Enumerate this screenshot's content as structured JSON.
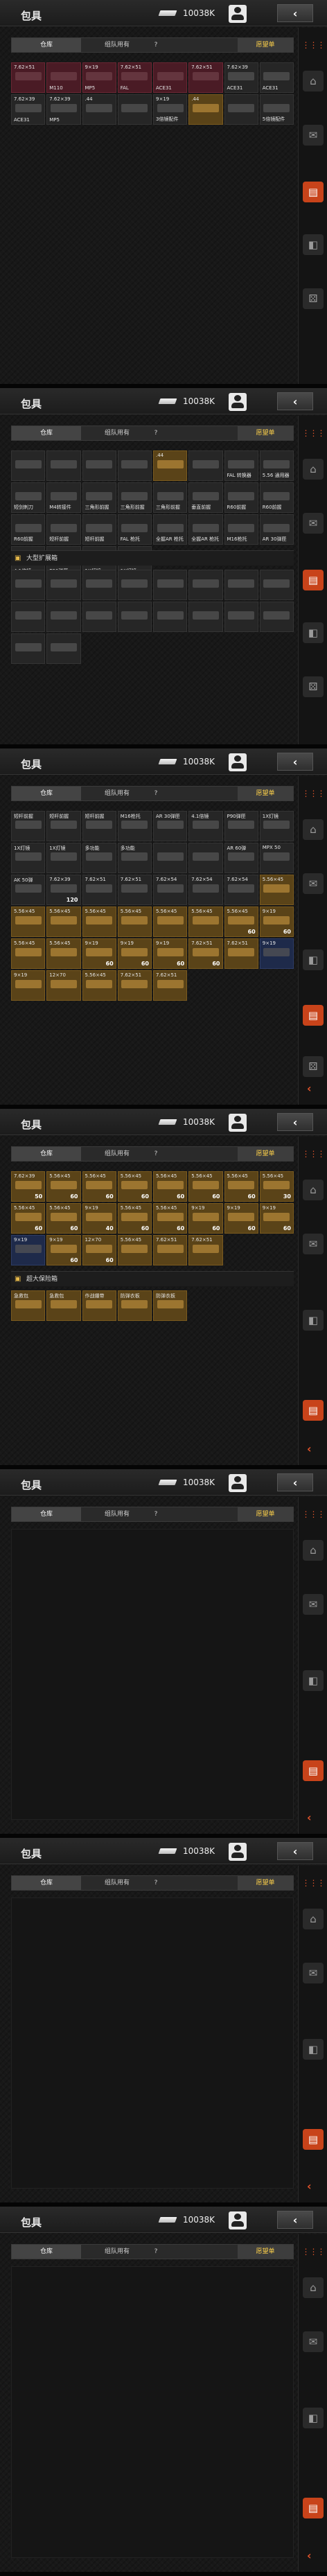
{
  "header": {
    "title": "包具",
    "money": "10038K",
    "back_icon": "‹"
  },
  "tabs": {
    "storage": "仓库",
    "team": "组队用有",
    "help": "?",
    "wishlist": "愿望单"
  },
  "sidebar": {
    "icons": [
      "dots-icon",
      "home-icon",
      "mail-icon",
      "backpack-icon",
      "cube-icon",
      "dice-icon",
      "caret-icon"
    ]
  },
  "sections": {
    "extended": "大型扩展箱",
    "large_keep": "超大保险箱"
  },
  "panel1_cells": [
    {
      "top": "7.62×51",
      "label": "",
      "count": "",
      "tone": "red"
    },
    {
      "top": "",
      "label": "M110",
      "count": "",
      "tone": "red"
    },
    {
      "top": "9×19",
      "label": "MP5",
      "count": "",
      "tone": "red"
    },
    {
      "top": "7.62×51",
      "label": "FAL",
      "count": "",
      "tone": "red"
    },
    {
      "top": "",
      "label": "ACE31",
      "count": "",
      "tone": "red"
    },
    {
      "top": "7.62×51",
      "label": "",
      "count": "",
      "tone": "red"
    },
    {
      "top": "7.62×39",
      "label": "ACE31",
      "count": "",
      "tone": ""
    },
    {
      "top": "",
      "label": "ACE31",
      "count": "",
      "tone": ""
    },
    {
      "top": "7.62×39",
      "label": "ACE31",
      "count": "",
      "tone": ""
    },
    {
      "top": "7.62×39",
      "label": "MP5",
      "count": "",
      "tone": ""
    },
    {
      "top": ".44",
      "label": "",
      "count": "",
      "tone": ""
    },
    {
      "top": "",
      "label": "",
      "count": "",
      "tone": ""
    },
    {
      "top": "9×19",
      "label": "3倍镜配件",
      "count": "",
      "tone": ""
    },
    {
      "top": ".44",
      "label": "",
      "count": "",
      "tone": "gold"
    },
    {
      "top": "",
      "label": "",
      "count": "",
      "tone": ""
    },
    {
      "top": "",
      "label": "5倍镜配件",
      "count": "",
      "tone": ""
    }
  ],
  "panel2_cells": [
    {
      "top": "",
      "label": "",
      "tone": ""
    },
    {
      "top": "",
      "label": "",
      "tone": ""
    },
    {
      "top": "",
      "label": "",
      "tone": ""
    },
    {
      "top": "",
      "label": "",
      "tone": ""
    },
    {
      "top": ".44",
      "label": "",
      "tone": "gold"
    },
    {
      "top": "",
      "label": "",
      "tone": ""
    },
    {
      "top": "",
      "label": "FAL 转换器",
      "tone": ""
    },
    {
      "top": "",
      "label": "5.56 通用器",
      "tone": ""
    },
    {
      "top": "",
      "label": "短剑刺刀",
      "tone": ""
    },
    {
      "top": "",
      "label": "M4转接件",
      "tone": ""
    },
    {
      "top": "",
      "label": "三角形前握",
      "tone": ""
    },
    {
      "top": "",
      "label": "三角形前握",
      "tone": ""
    },
    {
      "top": "",
      "label": "三角形前握",
      "tone": ""
    },
    {
      "top": "",
      "label": "垂直前握",
      "tone": ""
    },
    {
      "top": "",
      "label": "R60前握",
      "tone": ""
    },
    {
      "top": "",
      "label": "R60前握",
      "tone": ""
    },
    {
      "top": "",
      "label": "R60前握",
      "tone": ""
    },
    {
      "top": "",
      "label": "短杆前握",
      "tone": ""
    },
    {
      "top": "",
      "label": "短杆前握",
      "tone": ""
    },
    {
      "top": "",
      "label": "FAL 枪托",
      "tone": ""
    },
    {
      "top": "",
      "label": "全握AR 枪托",
      "tone": ""
    },
    {
      "top": "",
      "label": "全握AR 枪托",
      "tone": ""
    },
    {
      "top": "",
      "label": "M16枪托",
      "tone": ""
    },
    {
      "top": "",
      "label": "AR 30弹匣",
      "tone": ""
    },
    {
      "top": "",
      "label": "4.1倍镜",
      "tone": ""
    },
    {
      "top": "",
      "label": "P90弹匣",
      "tone": ""
    },
    {
      "top": "",
      "label": "1X灯镜",
      "tone": ""
    },
    {
      "top": "",
      "label": "1X灯镜",
      "tone": ""
    }
  ],
  "panel3_cells": [
    {
      "top": "短杆前握",
      "label": "",
      "count": "",
      "tone": ""
    },
    {
      "top": "短杆前握",
      "label": "",
      "count": "",
      "tone": ""
    },
    {
      "top": "短杆前握",
      "label": "",
      "count": "",
      "tone": ""
    },
    {
      "top": "M16枪托",
      "label": "",
      "count": "",
      "tone": ""
    },
    {
      "top": "AR 30弹匣",
      "label": "",
      "count": "",
      "tone": ""
    },
    {
      "top": "4.1倍镜",
      "label": "",
      "count": "",
      "tone": ""
    },
    {
      "top": "P90弹匣",
      "label": "",
      "count": "",
      "tone": ""
    },
    {
      "top": "1X灯镜",
      "label": "",
      "count": "",
      "tone": ""
    },
    {
      "top": "1X灯镜",
      "label": "",
      "count": "",
      "tone": ""
    },
    {
      "top": "1X灯镜",
      "label": "",
      "count": "",
      "tone": ""
    },
    {
      "top": "多功能",
      "label": "",
      "count": "",
      "tone": ""
    },
    {
      "top": "多功能",
      "label": "",
      "count": "",
      "tone": ""
    },
    {
      "top": "",
      "label": "",
      "count": "",
      "tone": ""
    },
    {
      "top": "",
      "label": "",
      "count": "",
      "tone": ""
    },
    {
      "top": "AR 60弹",
      "label": "",
      "count": "",
      "tone": ""
    },
    {
      "top": "MPX 50",
      "label": "",
      "count": "",
      "tone": ""
    },
    {
      "top": "AK 50弹",
      "label": "",
      "count": "",
      "tone": ""
    },
    {
      "top": "7.62×39",
      "label": "",
      "count": "120",
      "tone": ""
    },
    {
      "top": "7.62×51",
      "label": "",
      "count": "",
      "tone": ""
    },
    {
      "top": "7.62×51",
      "label": "",
      "count": "",
      "tone": ""
    },
    {
      "top": "7.62×54",
      "label": "",
      "count": "",
      "tone": ""
    },
    {
      "top": "7.62×54",
      "label": "",
      "count": "",
      "tone": ""
    },
    {
      "top": "7.62×54",
      "label": "",
      "count": "",
      "tone": ""
    },
    {
      "top": "5.56×45",
      "label": "",
      "count": "",
      "tone": "gold"
    },
    {
      "top": "5.56×45",
      "label": "",
      "count": "",
      "tone": "gold"
    },
    {
      "top": "5.56×45",
      "label": "",
      "count": "",
      "tone": "gold"
    },
    {
      "top": "5.56×45",
      "label": "",
      "count": "",
      "tone": "gold"
    },
    {
      "top": "5.56×45",
      "label": "",
      "count": "",
      "tone": "gold"
    },
    {
      "top": "5.56×45",
      "label": "",
      "count": "",
      "tone": "gold"
    },
    {
      "top": "5.56×45",
      "label": "",
      "count": "",
      "tone": "gold"
    },
    {
      "top": "5.56×45",
      "label": "",
      "count": "60",
      "tone": "gold"
    },
    {
      "top": "9×19",
      "label": "",
      "count": "60",
      "tone": "gold"
    },
    {
      "top": "5.56×45",
      "label": "",
      "count": "",
      "tone": "gold"
    },
    {
      "top": "5.56×45",
      "label": "",
      "count": "",
      "tone": "gold"
    },
    {
      "top": "9×19",
      "label": "",
      "count": "60",
      "tone": "gold"
    },
    {
      "top": "9×19",
      "label": "",
      "count": "60",
      "tone": "gold"
    },
    {
      "top": "9×19",
      "label": "",
      "count": "60",
      "tone": "gold"
    },
    {
      "top": "7.62×51",
      "label": "",
      "count": "60",
      "tone": "gold"
    },
    {
      "top": "7.62×51",
      "label": "",
      "count": "",
      "tone": "gold"
    },
    {
      "top": "9×19",
      "label": "",
      "count": "",
      "tone": "blue"
    },
    {
      "top": "9×19",
      "label": "",
      "count": "",
      "tone": "gold"
    },
    {
      "top": "12×70",
      "label": "",
      "count": "",
      "tone": "gold"
    },
    {
      "top": "5.56×45",
      "label": "",
      "count": "",
      "tone": "gold"
    },
    {
      "top": "7.62×51",
      "label": "",
      "count": "",
      "tone": "gold"
    },
    {
      "top": "7.62×51",
      "label": "",
      "count": "",
      "tone": "gold"
    }
  ],
  "panel4_cells": [
    {
      "top": "7.62×39",
      "label": "",
      "count": "50",
      "tone": "gold"
    },
    {
      "top": "5.56×45",
      "label": "",
      "count": "60",
      "tone": "gold"
    },
    {
      "top": "5.56×45",
      "label": "",
      "count": "60",
      "tone": "gold"
    },
    {
      "top": "5.56×45",
      "label": "",
      "count": "60",
      "tone": "gold"
    },
    {
      "top": "5.56×45",
      "label": "",
      "count": "60",
      "tone": "gold"
    },
    {
      "top": "5.56×45",
      "label": "",
      "count": "60",
      "tone": "gold"
    },
    {
      "top": "5.56×45",
      "label": "",
      "count": "60",
      "tone": "gold"
    },
    {
      "top": "5.56×45",
      "label": "",
      "count": "30",
      "tone": "gold"
    },
    {
      "top": "5.56×45",
      "label": "",
      "count": "60",
      "tone": "gold"
    },
    {
      "top": "5.56×45",
      "label": "",
      "count": "60",
      "tone": "gold"
    },
    {
      "top": "9×19",
      "label": "",
      "count": "40",
      "tone": "gold"
    },
    {
      "top": "5.56×45",
      "label": "",
      "count": "60",
      "tone": "gold"
    },
    {
      "top": "5.56×45",
      "label": "",
      "count": "60",
      "tone": "gold"
    },
    {
      "top": "9×19",
      "label": "",
      "count": "60",
      "tone": "gold"
    },
    {
      "top": "9×19",
      "label": "",
      "count": "60",
      "tone": "gold"
    },
    {
      "top": "9×19",
      "label": "",
      "count": "60",
      "tone": "gold"
    },
    {
      "top": "9×19",
      "label": "",
      "count": "",
      "tone": "blue"
    },
    {
      "top": "9×19",
      "label": "",
      "count": "60",
      "tone": "gold"
    },
    {
      "top": "12×70",
      "label": "",
      "count": "60",
      "tone": "gold"
    },
    {
      "top": "5.56×45",
      "label": "",
      "count": "",
      "tone": "gold"
    },
    {
      "top": "7.62×51",
      "label": "",
      "count": "",
      "tone": "gold"
    },
    {
      "top": "7.62×51",
      "label": "",
      "count": "",
      "tone": "gold"
    }
  ],
  "panel4_keep_cells": [
    {
      "top": "急救包",
      "label": "",
      "tone": "gold"
    },
    {
      "top": "急救包",
      "label": "",
      "tone": "gold"
    },
    {
      "top": "作战绷带",
      "label": "",
      "tone": "gold"
    },
    {
      "top": "防弹衣板",
      "label": "",
      "tone": "gold"
    },
    {
      "top": "防弹衣板",
      "label": "",
      "tone": "gold"
    }
  ]
}
